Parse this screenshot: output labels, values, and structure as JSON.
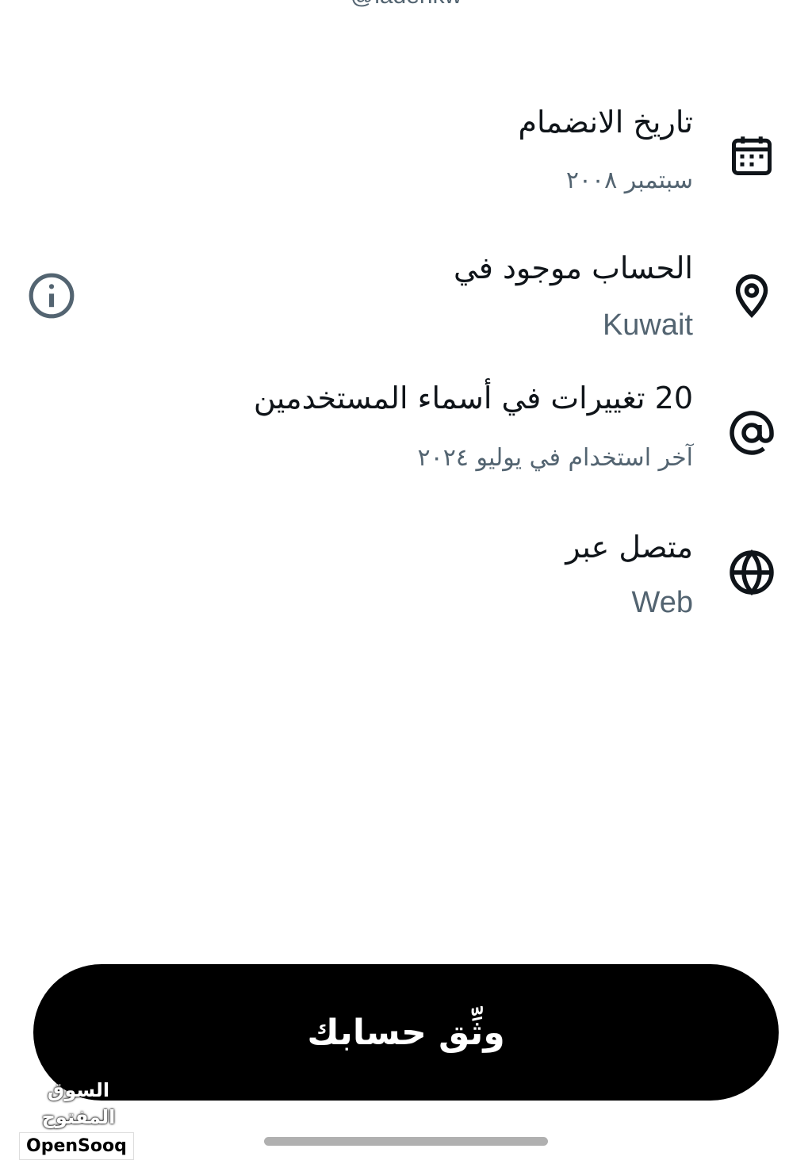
{
  "header": {
    "handle_partial": "@ladehkw"
  },
  "rows": [
    {
      "icon": "calendar-icon",
      "title": "تاريخ الانضمام",
      "subtitle": "سبتمبر ٢٠٠٨"
    },
    {
      "icon": "location-pin-icon",
      "title": "الحساب موجود في",
      "subtitle": "Kuwait"
    },
    {
      "icon": "at-sign-icon",
      "title": "20 تغييرات في أسماء المستخدمين",
      "subtitle": "آخر استخدام في يوليو ٢٠٢٤"
    },
    {
      "icon": "globe-icon",
      "title": "متصل عبر",
      "subtitle": "Web"
    }
  ],
  "info": {
    "icon": "info-icon"
  },
  "footer": {
    "verify_button_label": "وثِّق حسابك"
  },
  "watermark": {
    "arabic": "السوق المفتوح",
    "english": "OpenSooq"
  },
  "colors": {
    "primary_text": "#0f1419",
    "secondary_text": "#536471",
    "button_bg": "#000000",
    "button_text": "#ffffff"
  }
}
